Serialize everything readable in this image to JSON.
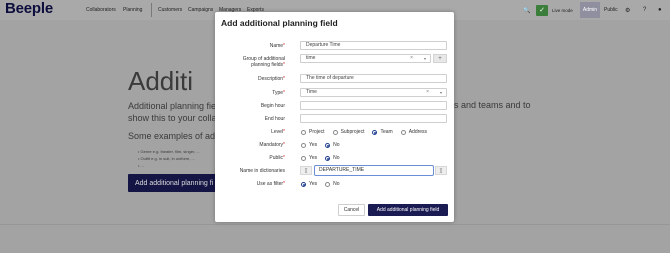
{
  "app": {
    "logo": "Beeple",
    "nav": [
      "Collaborators",
      "Planning",
      "Customers",
      "Campaigns",
      "Managers",
      "Exports"
    ],
    "search_icon": "🔍",
    "live_mode": "Live mode",
    "admin": "Admin",
    "public": "Public",
    "settings_icon": "⚙",
    "help_icon": "?",
    "user_icon": "●"
  },
  "background": {
    "title": "Additi",
    "text": "Additional planning field show this to your collab",
    "text_right": "s and teams and to",
    "subtitle": "Some examples of addit",
    "list": [
      "Genre e.g. theater, film, singer, ...",
      "Outfit e.g. in suit, in uniform, ...",
      "..."
    ],
    "button": "Add additional planning fi"
  },
  "modal": {
    "title": "Add additional planning field",
    "required_mark": "*",
    "name_label": "Name",
    "name_value": "Departure Time",
    "group_label": "Group of additional planning fields",
    "group_value": "time",
    "group_clear": "×",
    "group_caret": "▾",
    "group_add": "+",
    "description_label": "Description",
    "description_value": "The time of departure",
    "type_label": "Type",
    "type_value": "Time",
    "type_clear": "×",
    "type_caret": "▾",
    "begin_hour_label": "Begin hour",
    "end_hour_label": "End hour",
    "level_label": "Level",
    "level_options": [
      "Project",
      "Subproject",
      "Team",
      "Address"
    ],
    "mandatory_label": "Mandatory",
    "mandatory_options": [
      "Yes",
      "No"
    ],
    "public_label": "Public",
    "public_options": [
      "Yes",
      "No"
    ],
    "dict_label": "Name in dictionaries",
    "dict_value": "DEPARTURE_TIME",
    "dict_handle_left": "[[",
    "dict_handle_right": "]]",
    "filter_label": "Use as filter",
    "filter_options": [
      "Yes",
      "No"
    ],
    "cancel": "Cancel",
    "submit": "Add additional planning field"
  }
}
